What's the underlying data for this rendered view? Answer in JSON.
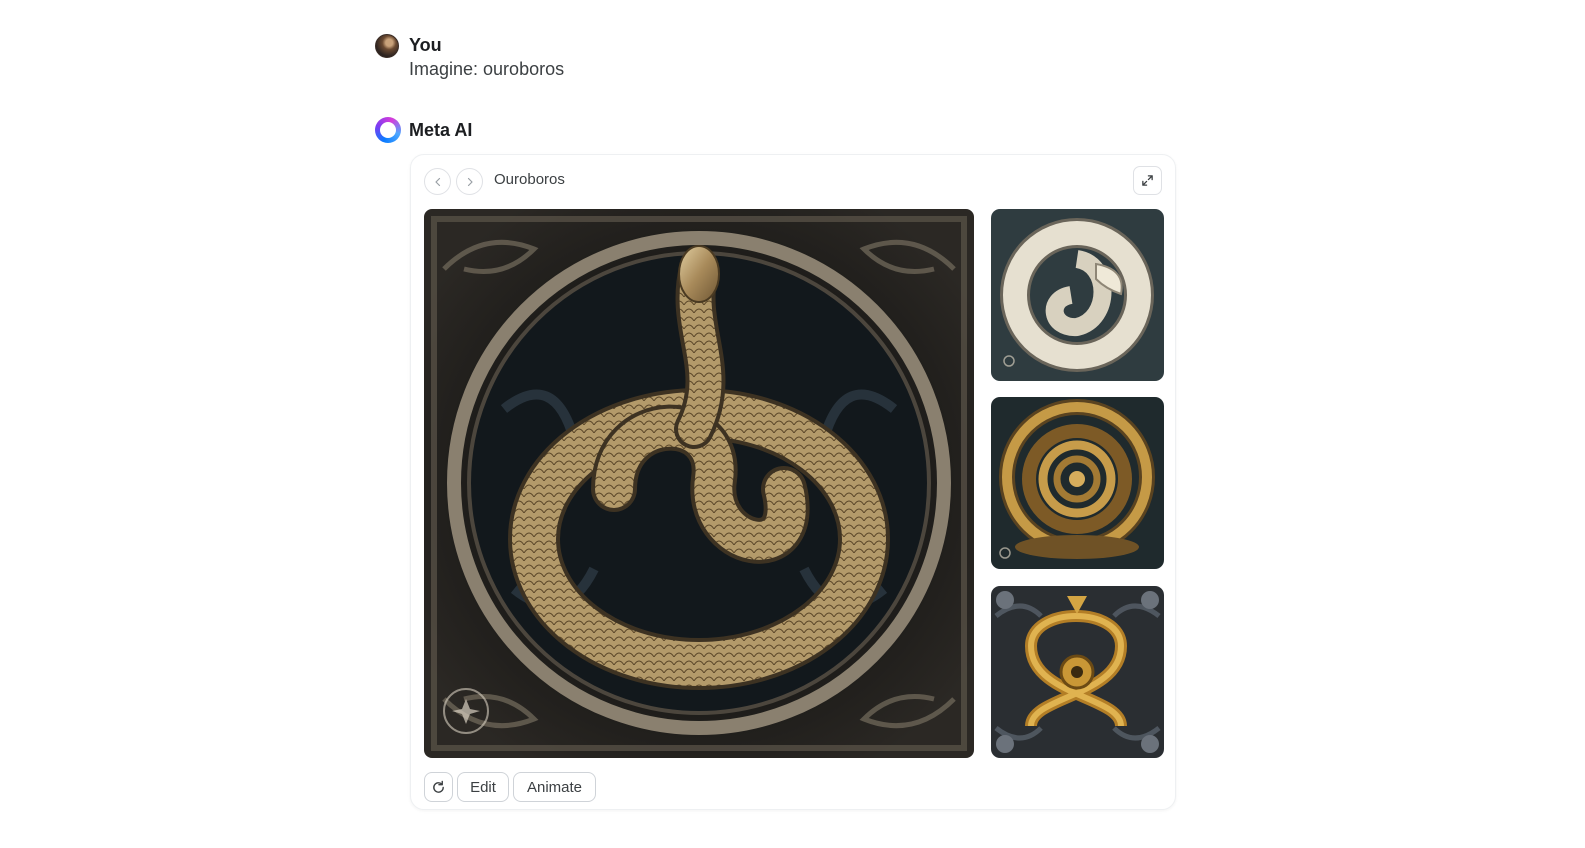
{
  "user_message": {
    "name": "You",
    "text": "Imagine: ouroboros"
  },
  "ai_message": {
    "name": "Meta AI"
  },
  "card": {
    "title": "Ouroboros",
    "actions": {
      "edit_label": "Edit",
      "animate_label": "Animate"
    }
  },
  "icons": {
    "prev": "chevron-left-icon",
    "next": "chevron-right-icon",
    "expand": "expand-icon",
    "regenerate": "refresh-icon"
  },
  "colors": {
    "image_gold": "#b08a52",
    "image_dark": "#1e1d1b",
    "thumb_teal_bg": "#2f3c40"
  }
}
